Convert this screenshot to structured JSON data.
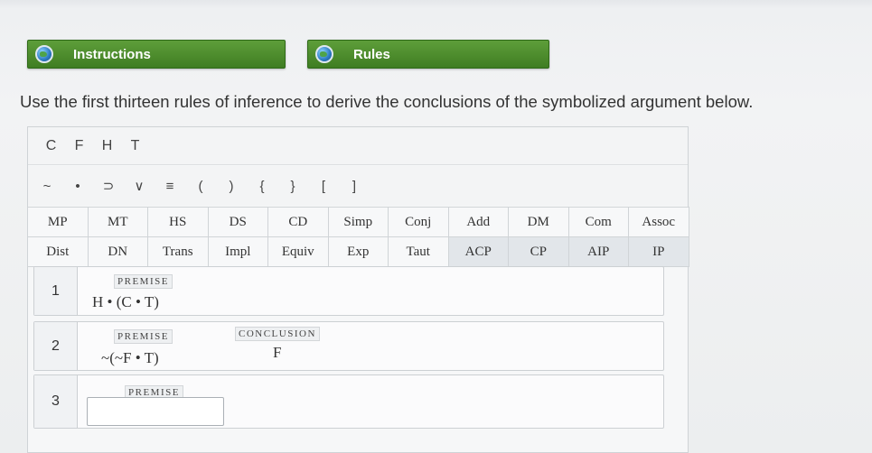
{
  "tabs": {
    "instructions_label": "Instructions",
    "rules_label": "Rules"
  },
  "instructions_text": "Use the first thirteen rules of inference to derive the conclusions of the symbolized argument below.",
  "variables": [
    "C",
    "F",
    "H",
    "T"
  ],
  "symbols": [
    "~",
    "•",
    "⊃",
    "∨",
    "≡",
    "(",
    ")",
    "{",
    "}",
    "[",
    "]"
  ],
  "rules_row1": [
    "MP",
    "MT",
    "HS",
    "DS",
    "CD",
    "Simp",
    "Conj",
    "Add",
    "DM",
    "Com",
    "Assoc"
  ],
  "rules_row2": [
    "Dist",
    "DN",
    "Trans",
    "Impl",
    "Equiv",
    "Exp",
    "Taut",
    "ACP",
    "CP",
    "AIP",
    "IP"
  ],
  "lines": [
    {
      "number": "1",
      "tag": "PREMISE",
      "formula": "H • (C • T)"
    },
    {
      "number": "2",
      "tag": "PREMISE",
      "formula": "~(~F • T)",
      "conclusion_tag": "CONCLUSION",
      "conclusion": "F"
    },
    {
      "number": "3",
      "tag": "PREMISE",
      "formula": ""
    }
  ],
  "icons": {
    "tab_icon": "globe-icon"
  }
}
